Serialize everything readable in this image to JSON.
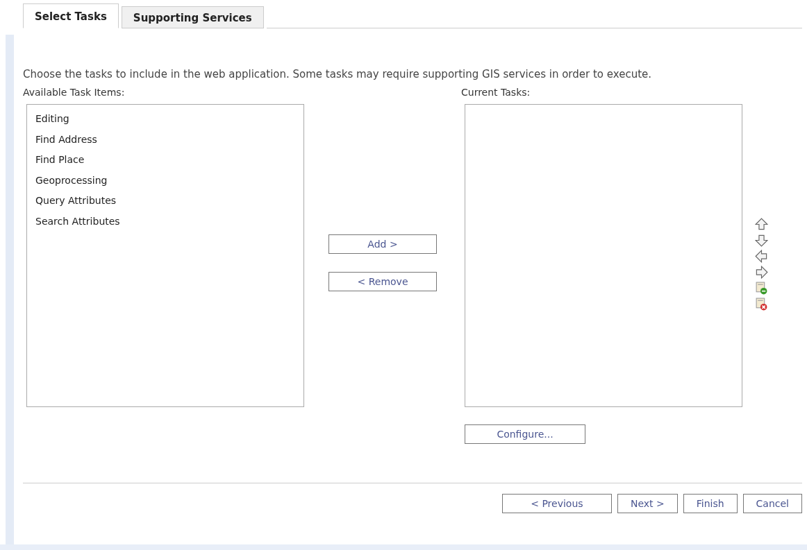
{
  "tabs": [
    {
      "label": "Select Tasks",
      "selected": true
    },
    {
      "label": "Supporting Services",
      "selected": false
    }
  ],
  "instructions": "Choose the tasks to include in the web application. Some tasks may require supporting GIS services in order to execute.",
  "available": {
    "label": "Available Task Items:",
    "items": [
      "Editing",
      "Find Address",
      "Find Place",
      "Geoprocessing",
      "Query Attributes",
      "Search Attributes"
    ]
  },
  "transfer_buttons": [
    "Add >",
    "< Remove"
  ],
  "current": {
    "label": "Current Tasks:"
  },
  "configure_button": "Configure...",
  "footer_buttons": [
    "< Previous",
    "Next >",
    "Finish",
    "Cancel"
  ]
}
